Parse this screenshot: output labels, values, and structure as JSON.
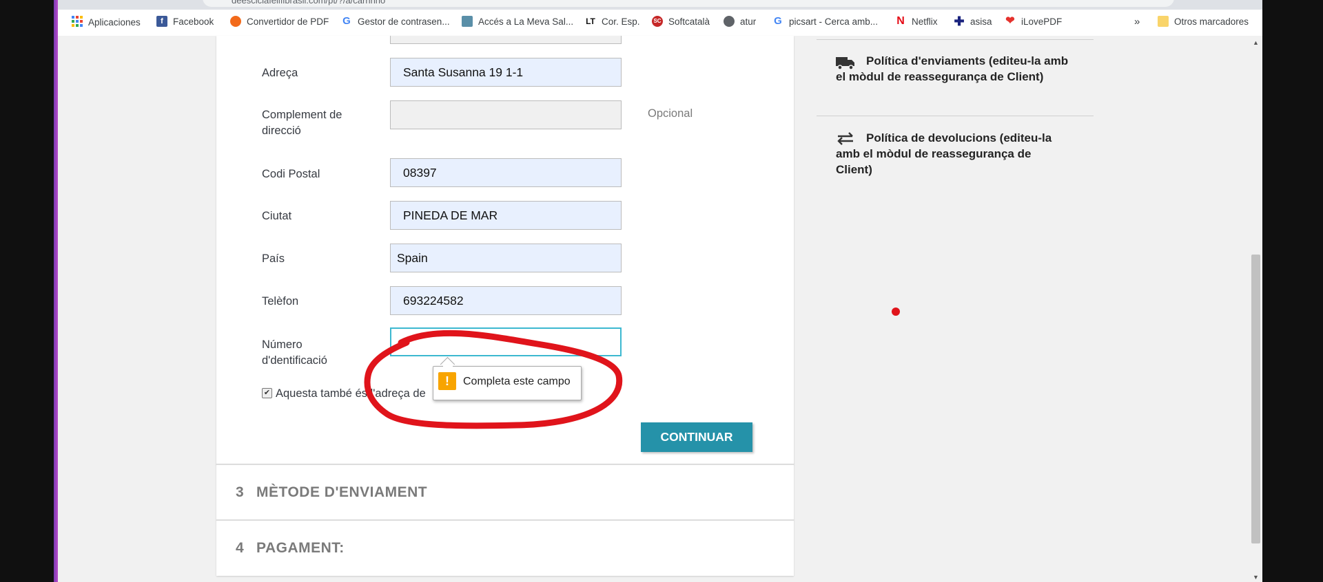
{
  "browser": {
    "url": "deesciclafelifibrasil.com/pt/?/a/carrinho",
    "bookmarks": [
      {
        "label": "Aplicaciones",
        "icon": "apps-grid-icon"
      },
      {
        "label": "Facebook",
        "icon": "facebook-icon"
      },
      {
        "label": "Convertidor de PDF",
        "icon": "pdf-converter-icon"
      },
      {
        "label": "Gestor de contrasen...",
        "icon": "google-icon"
      },
      {
        "label": "Accés a La Meva Sal...",
        "icon": "health-icon"
      },
      {
        "label": "Cor. Esp.",
        "icon": "lt-icon"
      },
      {
        "label": "Softcatalà",
        "icon": "softcatala-icon"
      },
      {
        "label": "atur",
        "icon": "globe-icon"
      },
      {
        "label": "picsart - Cerca amb...",
        "icon": "google-icon"
      },
      {
        "label": "Netflix",
        "icon": "netflix-icon"
      },
      {
        "label": "asisa",
        "icon": "asisa-icon"
      },
      {
        "label": "iLovePDF",
        "icon": "ilovepdf-icon"
      }
    ],
    "overflow_label": "»",
    "other_bookmarks": "Otros marcadores"
  },
  "form": {
    "fields": [
      {
        "label": "Adreça",
        "value": "Santa Susanna 19 1-1"
      },
      {
        "label": "Complement de direcció",
        "value": "",
        "hint": "Opcional"
      },
      {
        "label": "Codi Postal",
        "value": "08397"
      },
      {
        "label": "Ciutat",
        "value": "PINEDA DE MAR"
      },
      {
        "label": "País",
        "value": "Spain"
      },
      {
        "label": "Telèfon",
        "value": "693224582"
      },
      {
        "label": "Número d'dentificació",
        "value": ""
      }
    ],
    "checkbox_label": "Aquesta també és l'adreça de",
    "continue_label": "CONTINUAR",
    "tooltip": "Completa este campo"
  },
  "sections": [
    {
      "num": "3",
      "title": "MÈTODE D'ENVIAMENT"
    },
    {
      "num": "4",
      "title": "PAGAMENT:"
    }
  ],
  "sidebar": {
    "shipping_policy": "Política d'enviaments (editeu-la amb el mòdul de reassegurança de Client)",
    "return_policy": "Política de devolucions (editeu-la amb el mòdul de reassegurança de Client)"
  },
  "colors": {
    "accent": "#2592a9",
    "autofill": "#e8f0fe",
    "annotation": "#e0141b",
    "warning": "#f8a400"
  }
}
